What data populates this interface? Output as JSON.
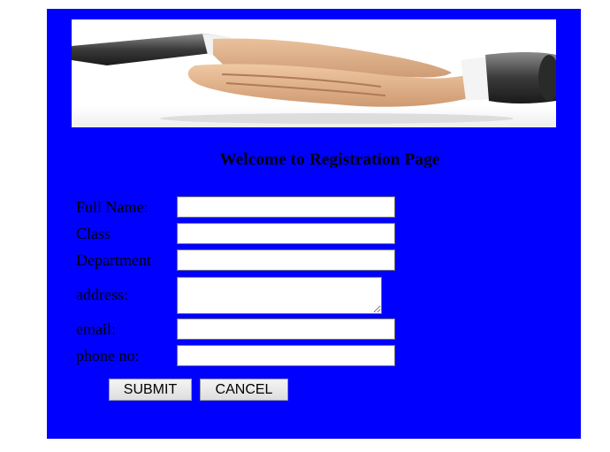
{
  "page": {
    "background": "#ffffff",
    "panel_color": "#0000ff"
  },
  "banner": {
    "image": "handshake-image"
  },
  "heading": "Welcome to Registration Page",
  "form": {
    "full_name": {
      "label": "Full Name:",
      "value": ""
    },
    "class": {
      "label": "Class",
      "value": ""
    },
    "department": {
      "label": "Department",
      "value": ""
    },
    "address": {
      "label": "address:",
      "value": ""
    },
    "email": {
      "label": "email:",
      "value": ""
    },
    "phone": {
      "label": "phone no:",
      "value": ""
    }
  },
  "buttons": {
    "submit": "SUBMIT",
    "cancel": "CANCEL"
  }
}
